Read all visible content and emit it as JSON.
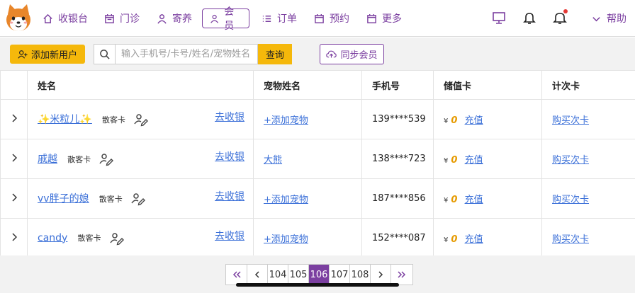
{
  "nav": {
    "items": [
      {
        "label": "收银台",
        "icon": "home-icon"
      },
      {
        "label": "门诊",
        "icon": "calendar-icon"
      },
      {
        "label": "寄养",
        "icon": "user-icon"
      },
      {
        "label": "会员",
        "icon": "user-icon",
        "active": true
      },
      {
        "label": "订单",
        "icon": "list-icon"
      },
      {
        "label": "预约",
        "icon": "calendar-icon"
      },
      {
        "label": "更多",
        "icon": "calendar-icon"
      }
    ],
    "help_label": "帮助"
  },
  "toolbar": {
    "add_user_label": "添加新用户",
    "search_placeholder": "输入手机号/卡号/姓名/宠物姓名",
    "query_label": "查询",
    "sync_label": "同步会员"
  },
  "table": {
    "headers": [
      "姓名",
      "宠物姓名",
      "手机号",
      "储值卡",
      "计次卡"
    ],
    "rows": [
      {
        "name": "✨米粒儿✨",
        "tag": "散客卡",
        "cashier": "去收银",
        "pet": "+添加宠物",
        "phone": "139****539",
        "yen": "¥",
        "balance": "0",
        "recharge": "充值",
        "buy": "购买次卡"
      },
      {
        "name": "戚越",
        "tag": "散客卡",
        "cashier": "去收银",
        "pet": "大熊",
        "phone": "138****723",
        "yen": "¥",
        "balance": "0",
        "recharge": "充值",
        "buy": "购买次卡"
      },
      {
        "name": "vv胖子的娘",
        "tag": "散客卡",
        "cashier": "去收银",
        "pet": "+添加宠物",
        "phone": "187****856",
        "yen": "¥",
        "balance": "0",
        "recharge": "充值",
        "buy": "购买次卡"
      },
      {
        "name": "candy",
        "tag": "散客卡",
        "cashier": "去收银",
        "pet": "+添加宠物",
        "phone": "152****087",
        "yen": "¥",
        "balance": "0",
        "recharge": "充值",
        "buy": "购买次卡"
      }
    ]
  },
  "pager": {
    "pages": [
      "104",
      "105",
      "106",
      "107",
      "108"
    ],
    "current": "106"
  },
  "colors": {
    "accent": "#7b3fa0",
    "button": "#f5b80b",
    "link": "#3a6fd8",
    "money": "#e69a00"
  }
}
